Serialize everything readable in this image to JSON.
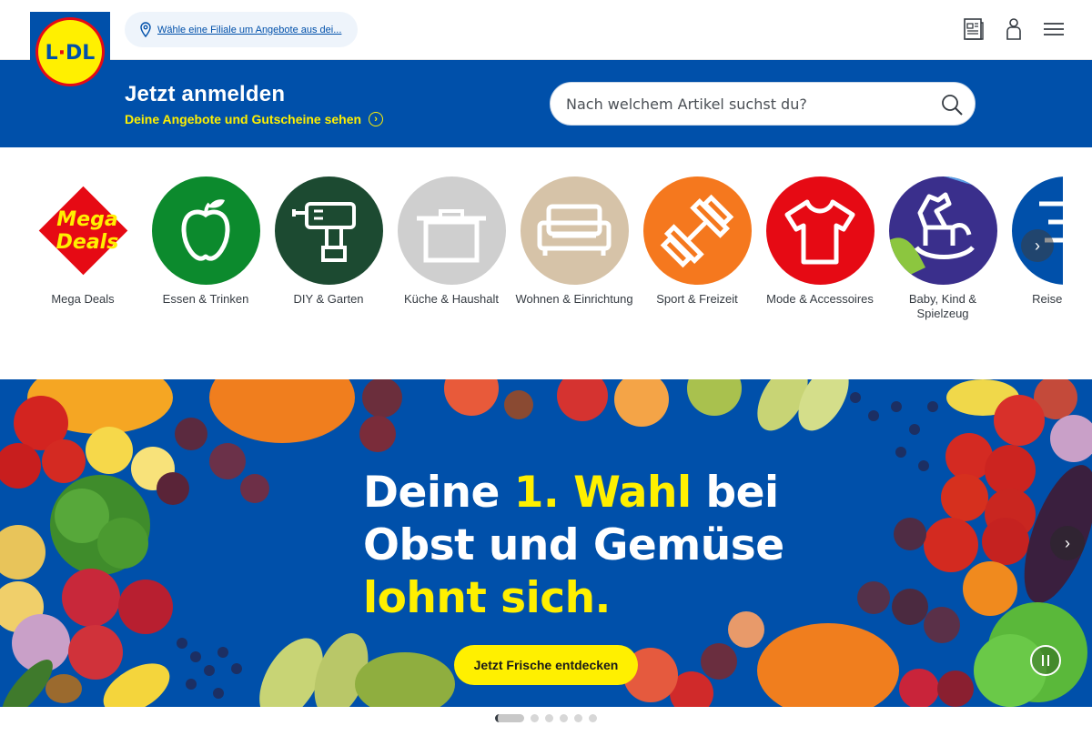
{
  "header": {
    "logo_text": "LIDL",
    "store_prompt": "Wähle eine Filiale um Angebote aus dei...",
    "icons": [
      "leaflet-icon",
      "user-icon",
      "menu-icon"
    ]
  },
  "login_band": {
    "title": "Jetzt anmelden",
    "subtitle": "Deine Angebote und Gutscheine sehen",
    "search_placeholder": "Nach welchem Artikel suchst du?"
  },
  "categories": [
    {
      "label": "Mega Deals",
      "badge_line1": "Mega",
      "badge_line2": "Deals",
      "color": "#e60a14"
    },
    {
      "label": "Essen & Trinken",
      "color": "#0c8a2d"
    },
    {
      "label": "DIY & Garten",
      "color": "#1c4a31"
    },
    {
      "label": "Küche & Haushalt",
      "color": "#cfcfcf"
    },
    {
      "label": "Wohnen & Einrichtung",
      "color": "#d6c3a8"
    },
    {
      "label": "Sport & Freizeit",
      "color": "#f5781e"
    },
    {
      "label": "Mode & Accessoires",
      "color": "#e60a14"
    },
    {
      "label": "Baby, Kind & Spielzeug",
      "color": "#3a2f8c"
    },
    {
      "label": "Reise Experi",
      "color": "#0050aa"
    }
  ],
  "hero": {
    "line1_a": "Deine ",
    "line1_b": "1. Wahl",
    "line1_c": " bei",
    "line2": "Obst und Gemüse",
    "line3": "lohnt sich.",
    "cta": "Jetzt Frische entdecken",
    "slide_count": 6,
    "active_slide": 1
  },
  "colors": {
    "brand_blue": "#0050aa",
    "brand_yellow": "#fff000",
    "brand_red": "#e60a14"
  }
}
